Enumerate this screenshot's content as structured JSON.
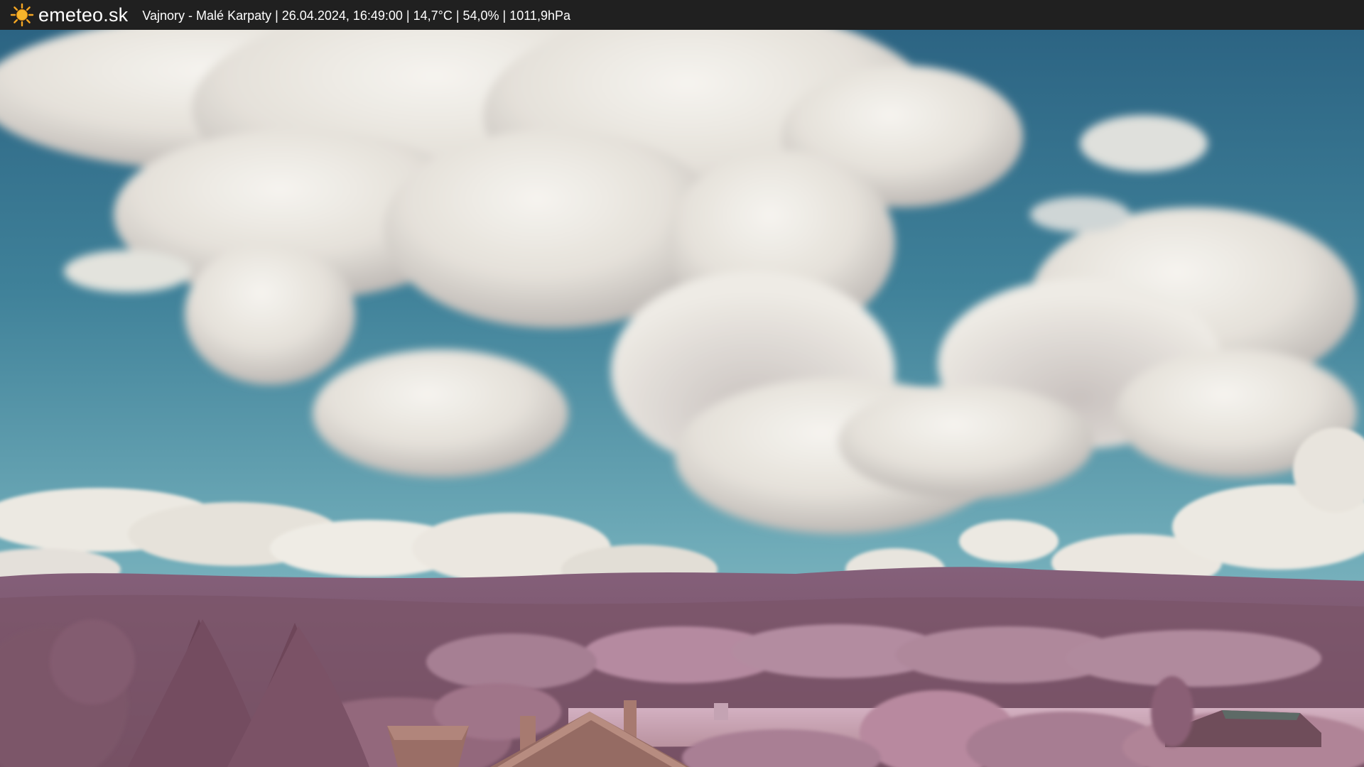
{
  "header": {
    "brand": "emeteo.sk",
    "caption": "Vajnory - Malé Karpaty | 26.04.2024, 16:49:00 | 14,7°C | 54,0% | 1011,9hPa"
  },
  "icons": {
    "logo": "sun-icon"
  },
  "colors": {
    "sky_top": "#2e6a86",
    "sky_bottom": "#86bcc6",
    "cloud": "#ebe8e1",
    "hills": "#7c5669",
    "foliage": "#a87a92",
    "field": "#c8a4b6",
    "bar": "#202020"
  }
}
